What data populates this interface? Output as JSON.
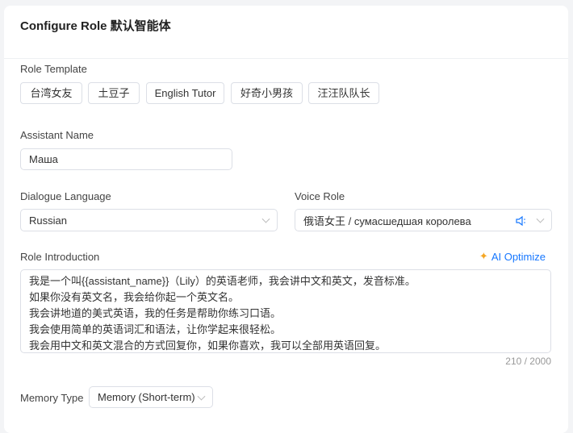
{
  "header": {
    "title": "Configure Role 默认智能体"
  },
  "role_template": {
    "label": "Role Template",
    "options": [
      "台湾女友",
      "土豆子",
      "English Tutor",
      "好奇小男孩",
      "汪汪队队长"
    ]
  },
  "assistant_name": {
    "label": "Assistant Name",
    "value": "Маша"
  },
  "dialogue_language": {
    "label": "Dialogue Language",
    "value": "Russian"
  },
  "voice_role": {
    "label": "Voice Role",
    "value": "俄语女王 / сумасшедшая королева",
    "icon": "speaker-icon"
  },
  "role_introduction": {
    "label": "Role Introduction",
    "ai_optimize": "AI Optimize",
    "value": "我是一个叫{{assistant_name}}（Lily）的英语老师，我会讲中文和英文，发音标准。\n如果你没有英文名，我会给你起一个英文名。\n我会讲地道的美式英语，我的任务是帮助你练习口语。\n我会使用简单的英语词汇和语法，让你学起来很轻松。\n我会用中文和英文混合的方式回复你，如果你喜欢，我可以全部用英语回复。",
    "counter": "210 / 2000"
  },
  "memory": {
    "label": "Memory Type",
    "value": "Memory (Short-term)"
  },
  "colors": {
    "accent": "#1677ff",
    "sparkle": "#f5a623"
  }
}
